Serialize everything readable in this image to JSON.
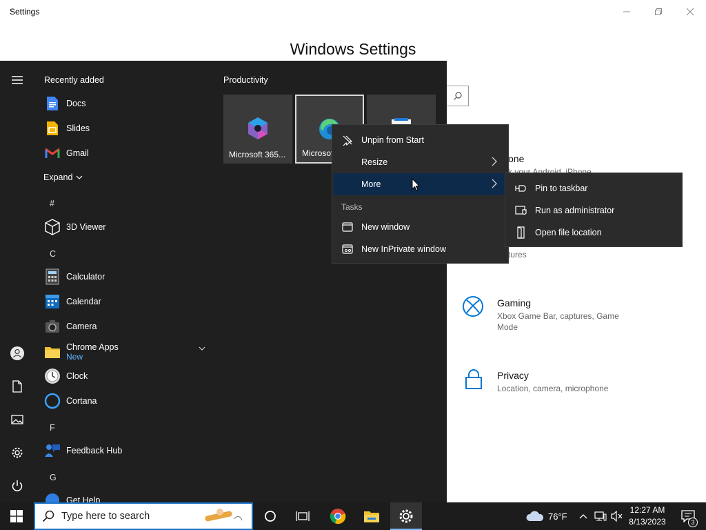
{
  "window": {
    "title": "Settings",
    "header": "Windows Settings"
  },
  "settings_bg": {
    "phone_fragment": "one",
    "phone_desc_fragment": "k your Android, iPhone",
    "tures_fragment": "tures",
    "gaming": {
      "title": "Gaming",
      "desc": "Xbox Game Bar, captures, Game Mode"
    },
    "privacy": {
      "title": "Privacy",
      "desc": "Location, camera, microphone"
    }
  },
  "start": {
    "recently_added": "Recently added",
    "recent": [
      "Docs",
      "Slides",
      "Gmail"
    ],
    "expand": "Expand",
    "letters": {
      "hash": "#",
      "c": "C",
      "f": "F",
      "g": "G"
    },
    "apps": {
      "viewer": "3D Viewer",
      "calculator": "Calculator",
      "calendar": "Calendar",
      "camera": "Camera",
      "chrome_apps": "Chrome Apps",
      "chrome_apps_badge": "New",
      "clock": "Clock",
      "cortana": "Cortana",
      "feedback": "Feedback Hub",
      "get_help": "Get Help"
    },
    "group": "Productivity",
    "tiles": [
      "Microsoft 365...",
      "Microsoft Edge"
    ]
  },
  "context_menu": {
    "unpin": "Unpin from Start",
    "resize": "Resize",
    "more": "More",
    "tasks": "Tasks",
    "new_window": "New window",
    "new_inprivate": "New InPrivate window"
  },
  "submenu": {
    "pin_taskbar": "Pin to taskbar",
    "run_admin": "Run as administrator",
    "open_location": "Open file location"
  },
  "taskbar": {
    "search_placeholder": "Type here to search",
    "weather": "76°F",
    "time": "12:27 AM",
    "date": "8/13/2023",
    "notification_count": "3"
  },
  "colors": {
    "accent": "#0078d4",
    "start_bg": "#1f1f1f",
    "highlight": "#0e2a4a"
  }
}
